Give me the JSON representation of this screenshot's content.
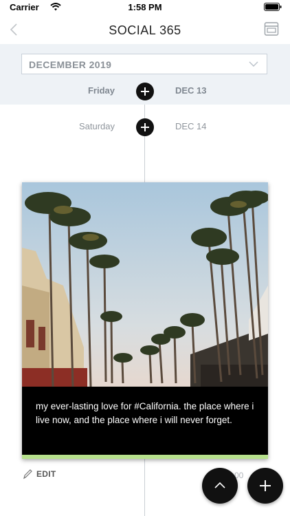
{
  "status_bar": {
    "carrier": "Carrier",
    "time": "1:58 PM"
  },
  "nav": {
    "title": "SOCIAL 365"
  },
  "month_picker": {
    "selected": "DECEMBER 2019"
  },
  "timeline": {
    "days": [
      {
        "day": "Friday",
        "date": "DEC 13",
        "highlighted": true
      },
      {
        "day": "Saturday",
        "date": "DEC 14",
        "highlighted": false
      }
    ]
  },
  "post": {
    "caption": "my ever-lasting love for #California. the place where i live now, and the place where i will never forget.",
    "edit_label": "EDIT",
    "time": "1:00",
    "status_color": "#b6e08c"
  },
  "icons": [
    "wifi-icon",
    "battery-icon",
    "back-icon",
    "tray-icon",
    "chevron-down-icon",
    "plus-icon",
    "pencil-icon",
    "chevron-up-icon"
  ]
}
